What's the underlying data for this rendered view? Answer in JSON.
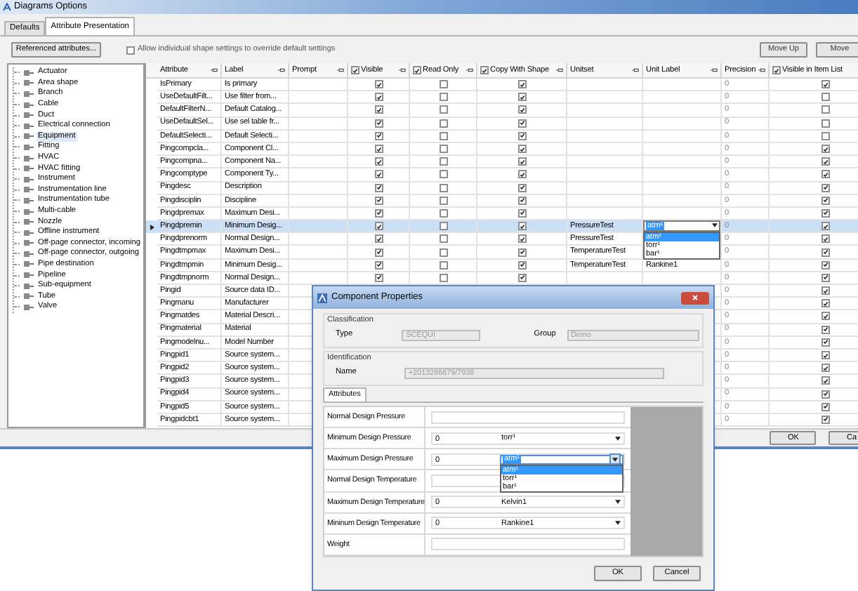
{
  "window": {
    "title": "Diagrams Options"
  },
  "tabs": [
    {
      "label": "Defaults",
      "selected": false
    },
    {
      "label": "Attribute Presentation",
      "selected": true
    }
  ],
  "toolbar": {
    "referenced_button": "Referenced attributes...",
    "override_option": {
      "label": "Allow individual shape settings to override default settings",
      "checked": false
    },
    "move_buttons": [
      "Move Up",
      "Move"
    ]
  },
  "shape_tree": [
    {
      "label": "Actuator",
      "selected": false
    },
    {
      "label": "Area shape",
      "selected": false
    },
    {
      "label": "Branch",
      "selected": false
    },
    {
      "label": "Cable",
      "selected": false
    },
    {
      "label": "Duct",
      "selected": false
    },
    {
      "label": "Electrical connection",
      "selected": false
    },
    {
      "label": "Equipment",
      "selected": true
    },
    {
      "label": "Fitting",
      "selected": false
    },
    {
      "label": "HVAC",
      "selected": false
    },
    {
      "label": "HVAC fitting",
      "selected": false
    },
    {
      "label": "Instrument",
      "selected": false
    },
    {
      "label": "Instrumentation line",
      "selected": false
    },
    {
      "label": "Instrumentation tube",
      "selected": false
    },
    {
      "label": "Multi-cable",
      "selected": false
    },
    {
      "label": "Nozzle",
      "selected": false
    },
    {
      "label": "Offline instrument",
      "selected": false
    },
    {
      "label": "Off-page connector, incoming",
      "selected": false
    },
    {
      "label": "Off-page connector, outgoing",
      "selected": false
    },
    {
      "label": "Pipe destination",
      "selected": false
    },
    {
      "label": "Pipeline",
      "selected": false
    },
    {
      "label": "Sub-equipment",
      "selected": false
    },
    {
      "label": "Tube",
      "selected": false
    },
    {
      "label": "Valve",
      "selected": false
    }
  ],
  "grid": {
    "columns": [
      {
        "label": "Attribute",
        "kind": "text"
      },
      {
        "label": "Label",
        "kind": "text"
      },
      {
        "label": "Prompt",
        "kind": "text"
      },
      {
        "label": "Visible",
        "kind": "check",
        "checked": true
      },
      {
        "label": "Read Only",
        "kind": "check",
        "checked": true
      },
      {
        "label": "Copy With Shape",
        "kind": "check",
        "checked": true
      },
      {
        "label": "Unitset",
        "kind": "text"
      },
      {
        "label": "Unit Label",
        "kind": "text"
      },
      {
        "label": "Precision",
        "kind": "text"
      },
      {
        "label": "Visible in Item List",
        "kind": "check",
        "checked": true
      }
    ],
    "rows": [
      {
        "attribute": "IsPrimary",
        "label": "Is primary",
        "visible": true,
        "read_only": false,
        "copy_with_shape": true,
        "precision": "0",
        "in_item_list": true,
        "selected": false
      },
      {
        "attribute": "UseDefaultFilt...",
        "label": "Use filter from...",
        "visible": true,
        "read_only": false,
        "copy_with_shape": true,
        "precision": "0",
        "in_item_list": false,
        "selected": false
      },
      {
        "attribute": "DefaultFilterN...",
        "label": "Default Catalog...",
        "visible": true,
        "read_only": false,
        "copy_with_shape": true,
        "precision": "0",
        "in_item_list": false,
        "selected": false
      },
      {
        "attribute": "UseDefaultSel...",
        "label": "Use sel table fr...",
        "visible": true,
        "read_only": false,
        "copy_with_shape": true,
        "precision": "0",
        "in_item_list": false,
        "selected": false
      },
      {
        "attribute": "DefaultSelecti...",
        "label": "Default Selecti...",
        "visible": true,
        "read_only": false,
        "copy_with_shape": true,
        "precision": "0",
        "in_item_list": false,
        "selected": false
      },
      {
        "attribute": "Pingcompcla...",
        "label": "Component Cl...",
        "visible": true,
        "read_only": false,
        "copy_with_shape": true,
        "precision": "0",
        "in_item_list": true,
        "selected": false
      },
      {
        "attribute": "Pingcompna...",
        "label": "Component Na...",
        "visible": true,
        "read_only": false,
        "copy_with_shape": true,
        "precision": "0",
        "in_item_list": true,
        "selected": false
      },
      {
        "attribute": "Pingcomptype",
        "label": "Component Ty...",
        "visible": true,
        "read_only": false,
        "copy_with_shape": true,
        "precision": "0",
        "in_item_list": true,
        "selected": false
      },
      {
        "attribute": "Pingdesc",
        "label": "Description",
        "visible": true,
        "read_only": false,
        "copy_with_shape": true,
        "precision": "0",
        "in_item_list": true,
        "selected": false
      },
      {
        "attribute": "Pingdisciplin",
        "label": "Discipline",
        "visible": true,
        "read_only": false,
        "copy_with_shape": true,
        "precision": "0",
        "in_item_list": true,
        "selected": false
      },
      {
        "attribute": "Pingdpremax",
        "label": "Maximum Desi...",
        "visible": true,
        "read_only": false,
        "copy_with_shape": true,
        "precision": "0",
        "in_item_list": true,
        "selected": false
      },
      {
        "attribute": "Pingdpremin",
        "label": "Minimum Desig...",
        "visible": true,
        "read_only": false,
        "copy_with_shape": true,
        "unitset": "PressureTest",
        "unit_label": "atm¹",
        "unit_options": [
          {
            "label": "atm¹",
            "selected": true
          },
          {
            "label": "torr¹",
            "selected": false
          },
          {
            "label": "bar¹",
            "selected": false
          }
        ],
        "precision": "0",
        "in_item_list": true,
        "selected": true
      },
      {
        "attribute": "Pingdprenorm",
        "label": "Normal Design...",
        "visible": true,
        "read_only": false,
        "copy_with_shape": true,
        "unitset": "PressureTest",
        "precision": "0",
        "in_item_list": true,
        "selected": false
      },
      {
        "attribute": "Pingdtmpmax",
        "label": "Maximum Desi...",
        "visible": true,
        "read_only": false,
        "copy_with_shape": true,
        "unitset": "TemperatureTest",
        "precision": "0",
        "in_item_list": true,
        "selected": false
      },
      {
        "attribute": "Pingdtmpmin",
        "label": "Minimum Desig...",
        "visible": true,
        "read_only": false,
        "copy_with_shape": true,
        "unitset": "TemperatureTest",
        "unit_label": "Rankine1",
        "precision": "0",
        "in_item_list": true,
        "selected": false
      },
      {
        "attribute": "Pingdtmpnorm",
        "label": "Normal Design...",
        "visible": true,
        "read_only": false,
        "copy_with_shape": true,
        "precision": "0",
        "in_item_list": true,
        "selected": false
      },
      {
        "attribute": "Pingid",
        "label": "Source data ID...",
        "precision": "0",
        "in_item_list": true,
        "selected": false
      },
      {
        "attribute": "Pingmanu",
        "label": "Manufacturer",
        "precision": "0",
        "in_item_list": true,
        "selected": false
      },
      {
        "attribute": "Pingmatdes",
        "label": "Material Descri...",
        "precision": "0",
        "in_item_list": true,
        "selected": false
      },
      {
        "attribute": "Pingmaterial",
        "label": "Material",
        "precision": "0",
        "in_item_list": true,
        "selected": false
      },
      {
        "attribute": "Pingmodelnu...",
        "label": "Model Number",
        "precision": "0",
        "in_item_list": true,
        "selected": false
      },
      {
        "attribute": "Pingpid1",
        "label": "Source system...",
        "precision": "0",
        "in_item_list": true,
        "selected": false
      },
      {
        "attribute": "Pingpid2",
        "label": "Source system...",
        "precision": "0",
        "in_item_list": true,
        "selected": false
      },
      {
        "attribute": "Pingpid3",
        "label": "Source system...",
        "precision": "0",
        "in_item_list": true,
        "selected": false
      },
      {
        "attribute": "Pingpid4",
        "label": "Source system...",
        "precision": "0",
        "in_item_list": true,
        "selected": false
      },
      {
        "attribute": "Pingpid5",
        "label": "Source system...",
        "precision": "0",
        "in_item_list": true,
        "selected": false
      },
      {
        "attribute": "Pingpidcbt1",
        "label": "Source system...",
        "precision": "0",
        "in_item_list": true,
        "selected": false
      }
    ]
  },
  "footer_buttons": [
    "OK",
    "Ca"
  ],
  "dialog": {
    "title": "Component Properties",
    "classification": {
      "heading": "Classification",
      "type_label": "Type",
      "type_value": "SCEQUI",
      "group_label": "Group",
      "group_value": "Demo"
    },
    "identification": {
      "heading": "Identification",
      "name_label": "Name",
      "name_value": "+2013286679/7938"
    },
    "tabs": [
      {
        "label": "Attributes",
        "selected": true
      }
    ],
    "attributes": [
      {
        "label": "Normal Design Pressure",
        "kind": "text"
      },
      {
        "label": "Minimum Design Pressure",
        "kind": "unit",
        "value": "0",
        "unit": "torr¹"
      },
      {
        "label": "Maximum Design Pressure",
        "kind": "unit",
        "value": "0",
        "unit": "atm¹",
        "options": [
          {
            "label": "atm¹",
            "selected": true
          },
          {
            "label": "torr¹",
            "selected": false
          },
          {
            "label": "bar¹",
            "selected": false
          }
        ]
      },
      {
        "label": "Normal Design Temperature",
        "kind": "text"
      },
      {
        "label": "Maximum Design Temperature",
        "kind": "unit",
        "value": "0",
        "unit": "Kelvin1"
      },
      {
        "label": "Mininum Design Temperature",
        "kind": "unit",
        "value": "0",
        "unit": "Rankine1"
      },
      {
        "label": "Weight",
        "kind": "text"
      }
    ],
    "buttons": [
      "OK",
      "Cancel"
    ]
  }
}
